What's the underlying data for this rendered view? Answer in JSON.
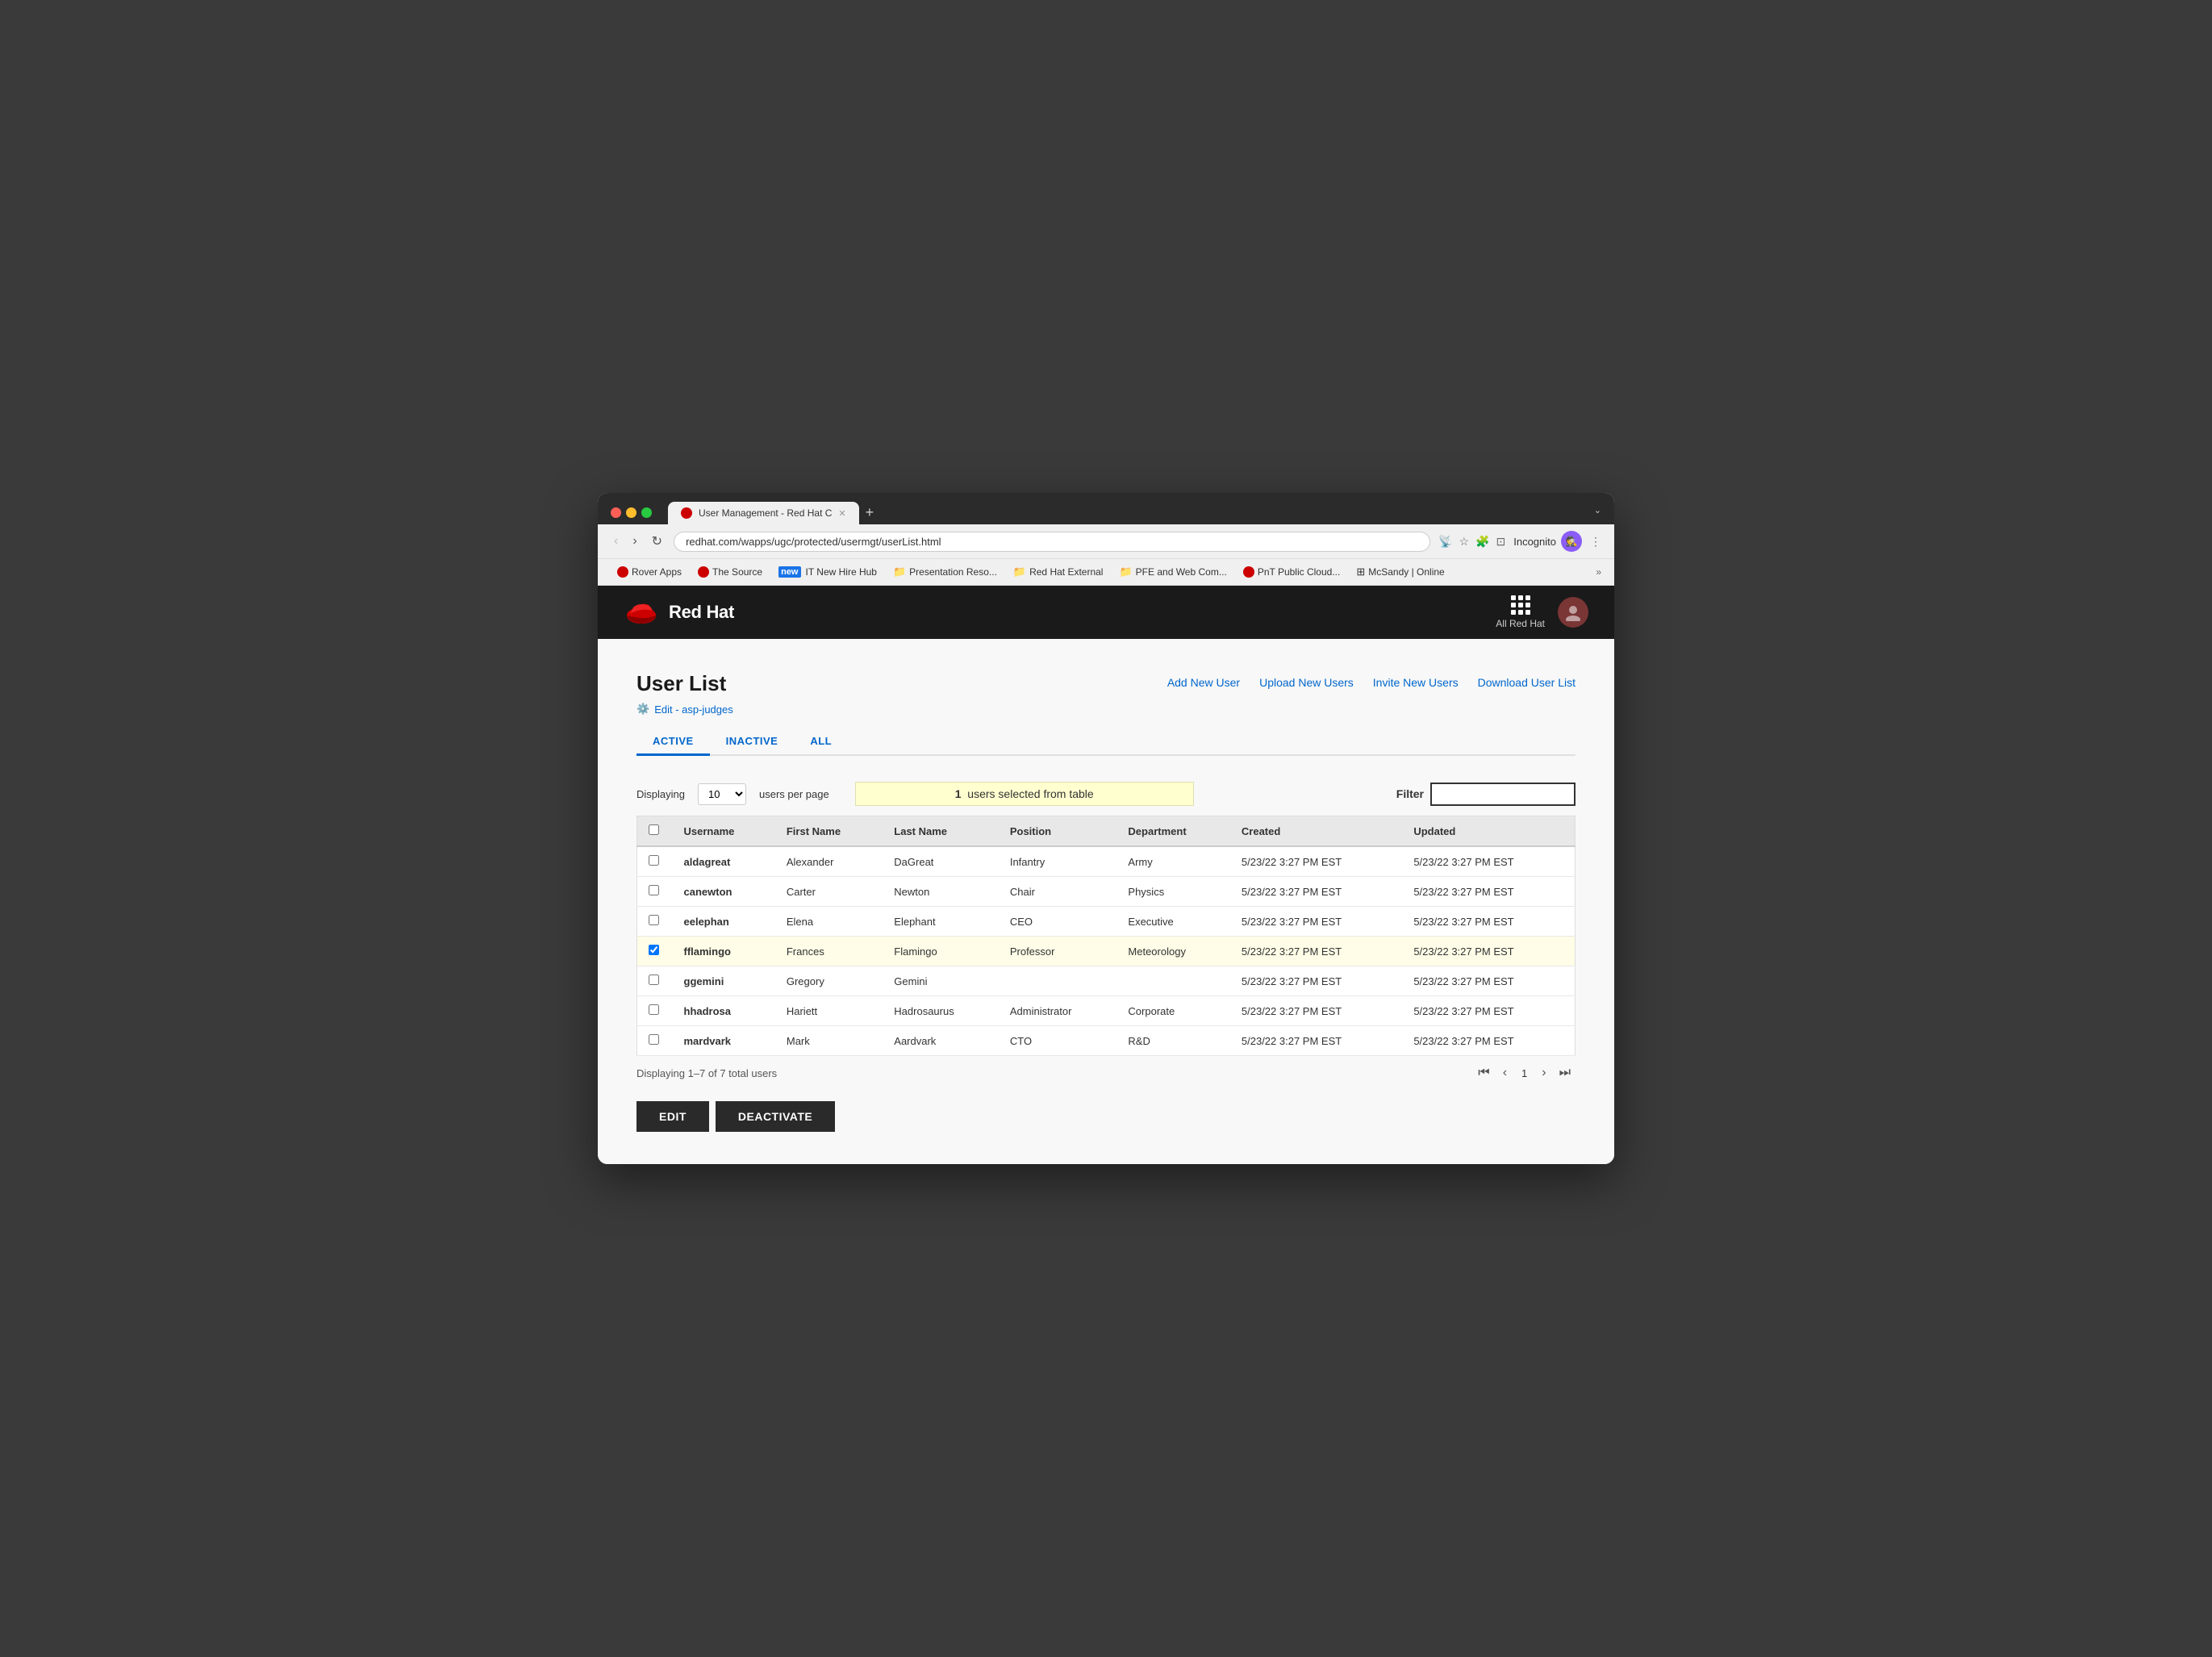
{
  "browser": {
    "tab_title": "User Management - Red Hat C",
    "address": "redhat.com/wapps/ugc/protected/usermgt/userList.html",
    "incognito_label": "Incognito",
    "bookmarks": [
      {
        "label": "Rover Apps",
        "type": "rh"
      },
      {
        "label": "The Source",
        "type": "rh"
      },
      {
        "label": "IT New Hire Hub",
        "type": "new"
      },
      {
        "label": "Presentation Reso...",
        "type": "folder"
      },
      {
        "label": "Red Hat External",
        "type": "folder"
      },
      {
        "label": "PFE and Web Com...",
        "type": "folder"
      },
      {
        "label": "PnT Public Cloud...",
        "type": "rh"
      },
      {
        "label": "McSandy | Online",
        "type": "grid"
      }
    ]
  },
  "header": {
    "logo_text": "Red Hat",
    "nav_label": "All Red Hat"
  },
  "page": {
    "title": "User List",
    "edit_link": "Edit - asp-judges",
    "actions": {
      "add": "Add New User",
      "upload": "Upload New Users",
      "invite": "Invite New Users",
      "download": "Download User List"
    },
    "tabs": [
      {
        "label": "ACTIVE",
        "active": true
      },
      {
        "label": "INACTIVE",
        "active": false
      },
      {
        "label": "ALL",
        "active": false
      }
    ],
    "table": {
      "displaying_label": "Displaying",
      "per_page": "10",
      "users_per_page_label": "users per page",
      "selection_banner": "users selected from table",
      "selection_count": "1",
      "filter_label": "Filter",
      "columns": [
        "Username",
        "First Name",
        "Last Name",
        "Position",
        "Department",
        "Created",
        "Updated"
      ],
      "rows": [
        {
          "username": "aldagreat",
          "first": "Alexander",
          "last": "DaGreat",
          "position": "Infantry",
          "department": "Army",
          "created": "5/23/22 3:27 PM EST",
          "updated": "5/23/22 3:27 PM EST",
          "selected": false
        },
        {
          "username": "canewton",
          "first": "Carter",
          "last": "Newton",
          "position": "Chair",
          "department": "Physics",
          "created": "5/23/22 3:27 PM EST",
          "updated": "5/23/22 3:27 PM EST",
          "selected": false
        },
        {
          "username": "eelephan",
          "first": "Elena",
          "last": "Elephant",
          "position": "CEO",
          "department": "Executive",
          "created": "5/23/22 3:27 PM EST",
          "updated": "5/23/22 3:27 PM EST",
          "selected": false
        },
        {
          "username": "fflamingo",
          "first": "Frances",
          "last": "Flamingo",
          "position": "Professor",
          "department": "Meteorology",
          "created": "5/23/22 3:27 PM EST",
          "updated": "5/23/22 3:27 PM EST",
          "selected": true
        },
        {
          "username": "ggemini",
          "first": "Gregory",
          "last": "Gemini",
          "position": "",
          "department": "",
          "created": "5/23/22 3:27 PM EST",
          "updated": "5/23/22 3:27 PM EST",
          "selected": false
        },
        {
          "username": "hhadrosa",
          "first": "Hariett",
          "last": "Hadrosaurus",
          "position": "Administrator",
          "department": "Corporate",
          "created": "5/23/22 3:27 PM EST",
          "updated": "5/23/22 3:27 PM EST",
          "selected": false
        },
        {
          "username": "mardvark",
          "first": "Mark",
          "last": "Aardvark",
          "position": "CTO",
          "department": "R&D",
          "created": "5/23/22 3:27 PM EST",
          "updated": "5/23/22 3:27 PM EST",
          "selected": false
        }
      ],
      "footer_label": "Displaying 1–7 of 7 total users",
      "page_number": "1"
    },
    "buttons": {
      "edit": "EDIT",
      "deactivate": "DEACTIVATE"
    }
  }
}
